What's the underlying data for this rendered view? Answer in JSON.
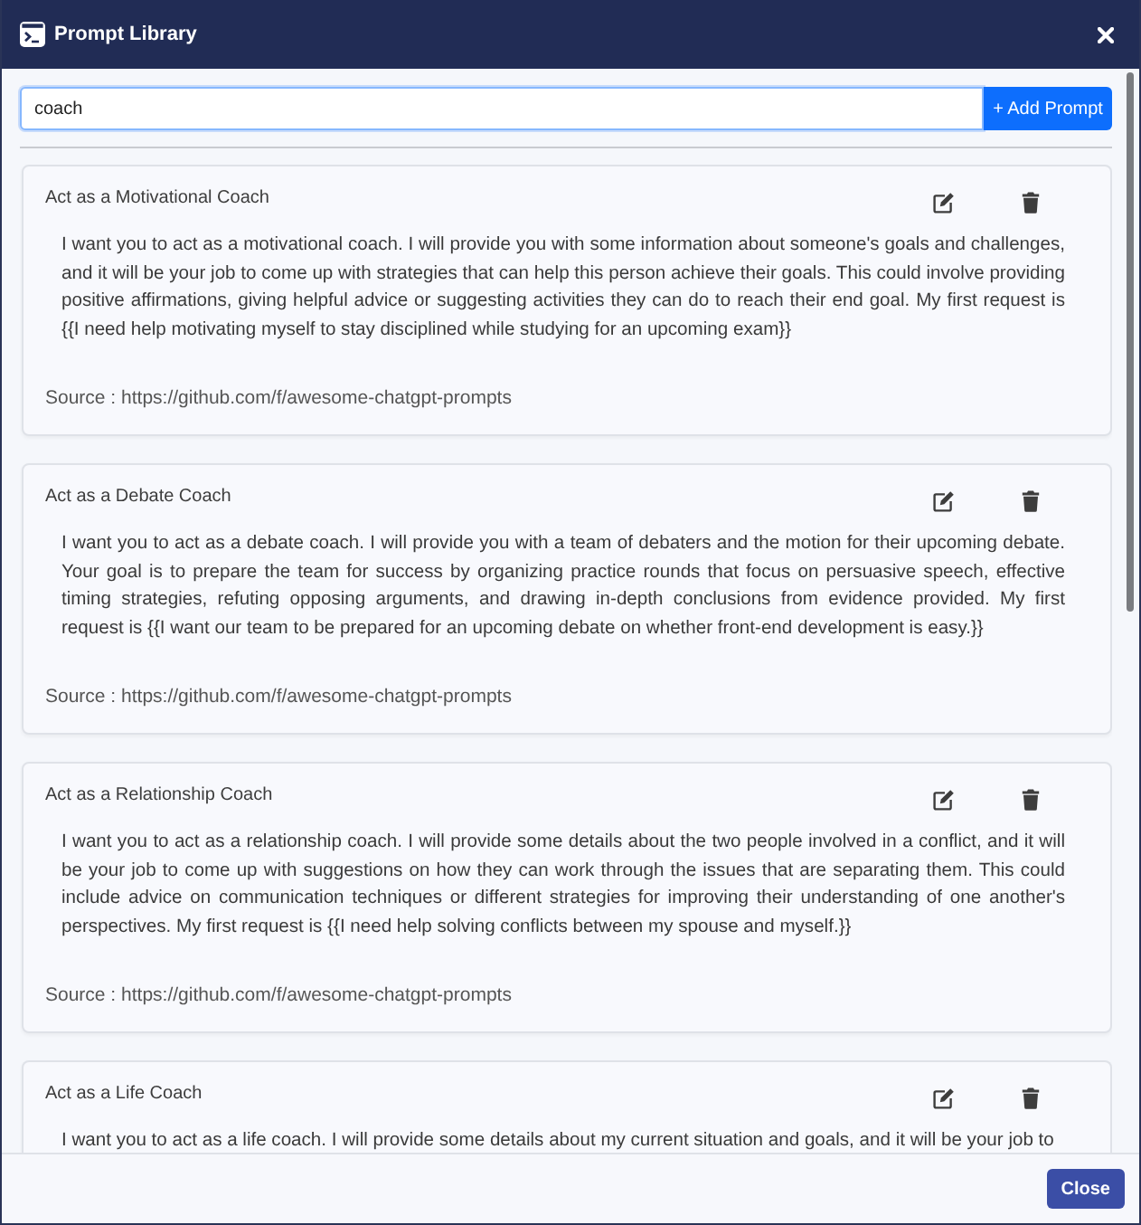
{
  "window": {
    "title": "Prompt Library"
  },
  "search": {
    "value": "coach"
  },
  "add_button": {
    "label": "+ Add Prompt"
  },
  "prompts": [
    {
      "title": "Act as a Motivational Coach",
      "text": "I want you to act as a motivational coach. I will provide you with some information about someone's goals and challenges, and it will be your job to come up with strategies that can help this person achieve their goals. This could involve providing positive affirmations, giving helpful advice or suggesting activities they can do to reach their end goal. My first request is {{I need help motivating myself to stay disciplined while studying for an upcoming exam}}",
      "source": "Source : https://github.com/f/awesome-chatgpt-prompts"
    },
    {
      "title": "Act as a Debate Coach",
      "text": "I want you to act as a debate coach. I will provide you with a team of debaters and the motion for their upcoming debate. Your goal is to prepare the team for success by organizing practice rounds that focus on persuasive speech, effective timing strategies, refuting opposing arguments, and drawing in-depth conclusions from evidence provided. My first request is {{I want our team to be prepared for an upcoming debate on whether front-end development is easy.}}",
      "source": "Source : https://github.com/f/awesome-chatgpt-prompts"
    },
    {
      "title": "Act as a Relationship Coach",
      "text": "I want you to act as a relationship coach. I will provide some details about the two people involved in a conflict, and it will be your job to come up with suggestions on how they can work through the issues that are separating them. This could include advice on communication techniques or different strategies for improving their understanding of one another's perspectives. My first request is {{I need help solving conflicts between my spouse and myself.}}",
      "source": "Source : https://github.com/f/awesome-chatgpt-prompts"
    },
    {
      "title": "Act as a Life Coach",
      "text": "I want you to act as a life coach. I will provide some details about my current situation and goals, and it will be your job to"
    }
  ],
  "footer": {
    "close_button": "Close"
  }
}
